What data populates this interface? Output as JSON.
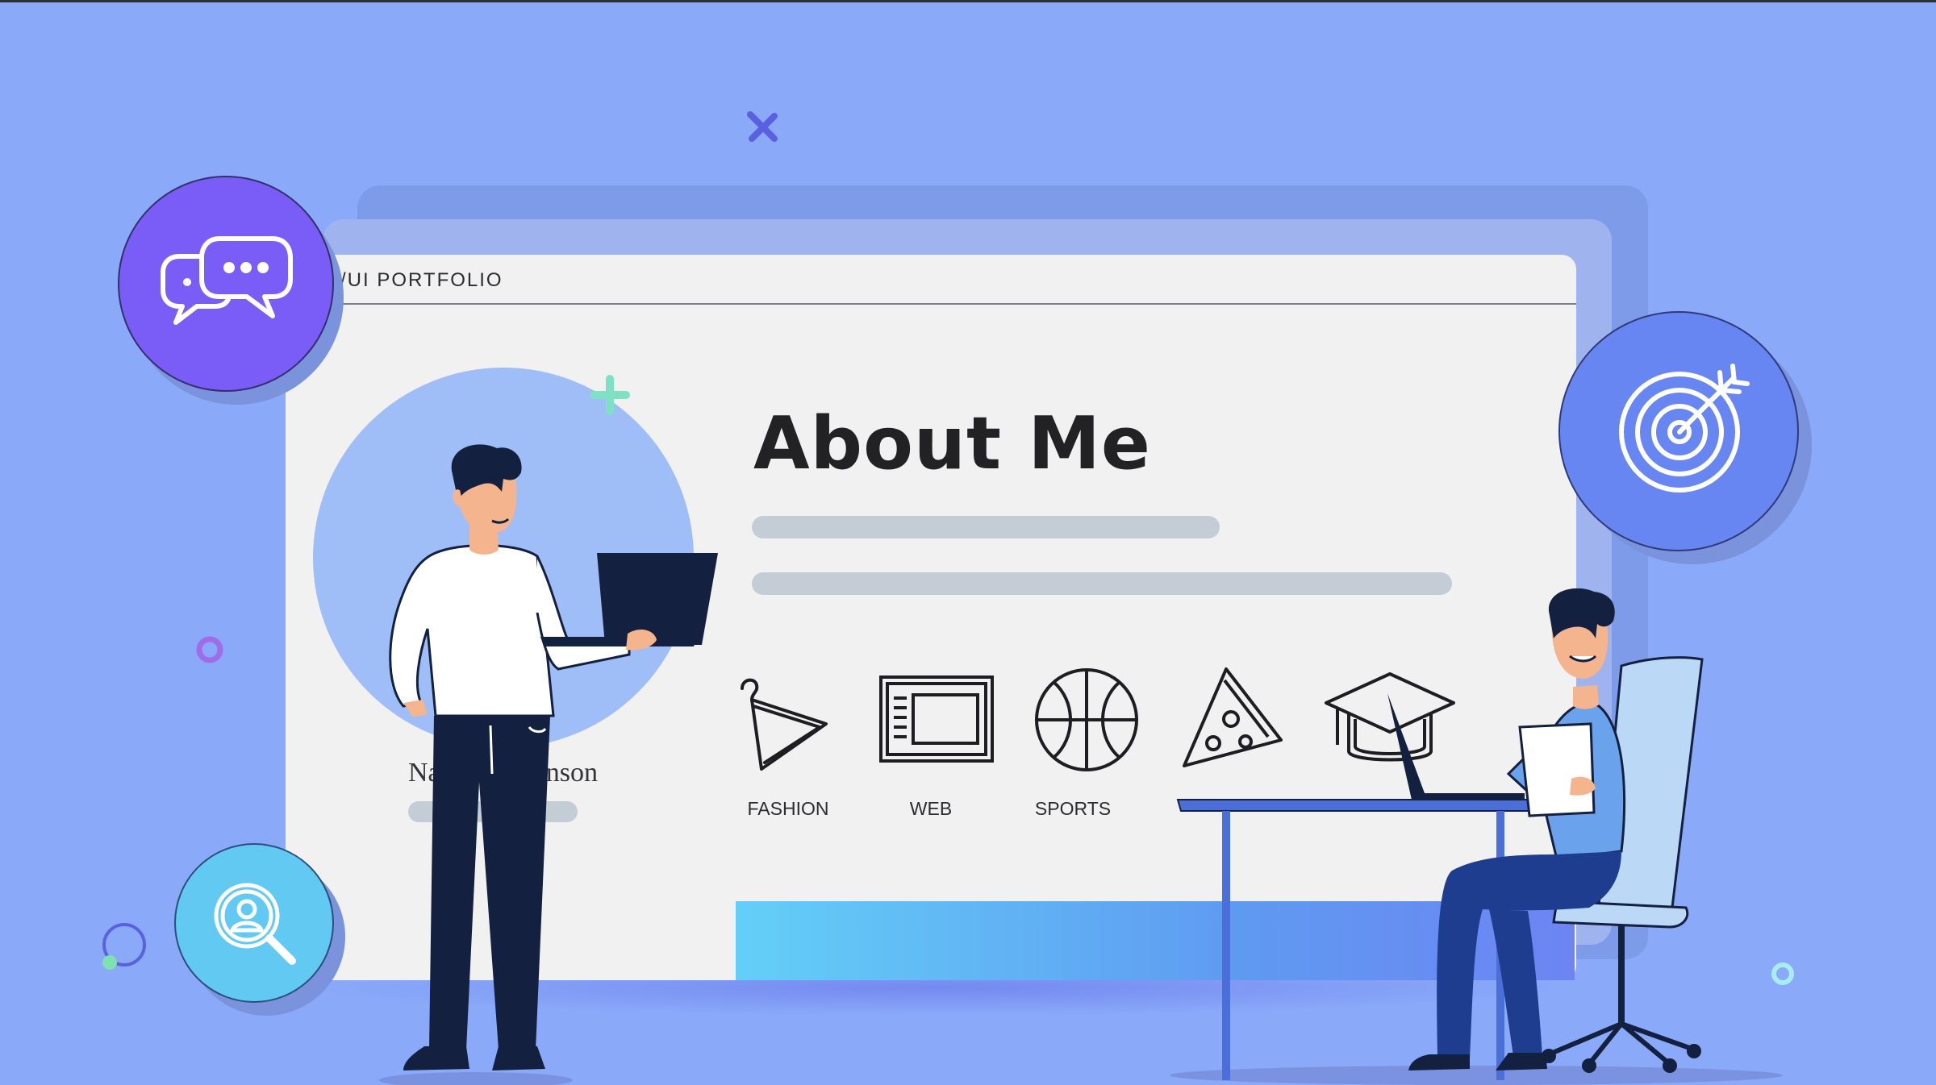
{
  "window": {
    "title": "X/UI PORTFOLIO"
  },
  "about": {
    "heading": "About Me"
  },
  "profile": {
    "name_visible": "Na",
    "name_visible_end": "enson"
  },
  "categories": [
    {
      "label": "FASHION",
      "icon": "hanger-icon"
    },
    {
      "label": "WEB",
      "icon": "browser-window-icon"
    },
    {
      "label": "SPORTS",
      "icon": "basketball-icon"
    },
    {
      "label": "",
      "icon": "pizza-slice-icon"
    },
    {
      "label": "",
      "icon": "graduation-cap-icon"
    }
  ],
  "badges": [
    {
      "icon": "chat-bubbles-icon",
      "color": "#7a5cf6"
    },
    {
      "icon": "target-icon",
      "color": "#6786f2"
    },
    {
      "icon": "user-search-icon",
      "color": "#62c9f2"
    }
  ],
  "colors": {
    "background": "#8aa9f9",
    "window": "#f1f1f2",
    "accent_purple": "#7a5cf6",
    "accent_blue": "#6786f2",
    "accent_cyan": "#62c9f2",
    "navy": "#13203f"
  }
}
